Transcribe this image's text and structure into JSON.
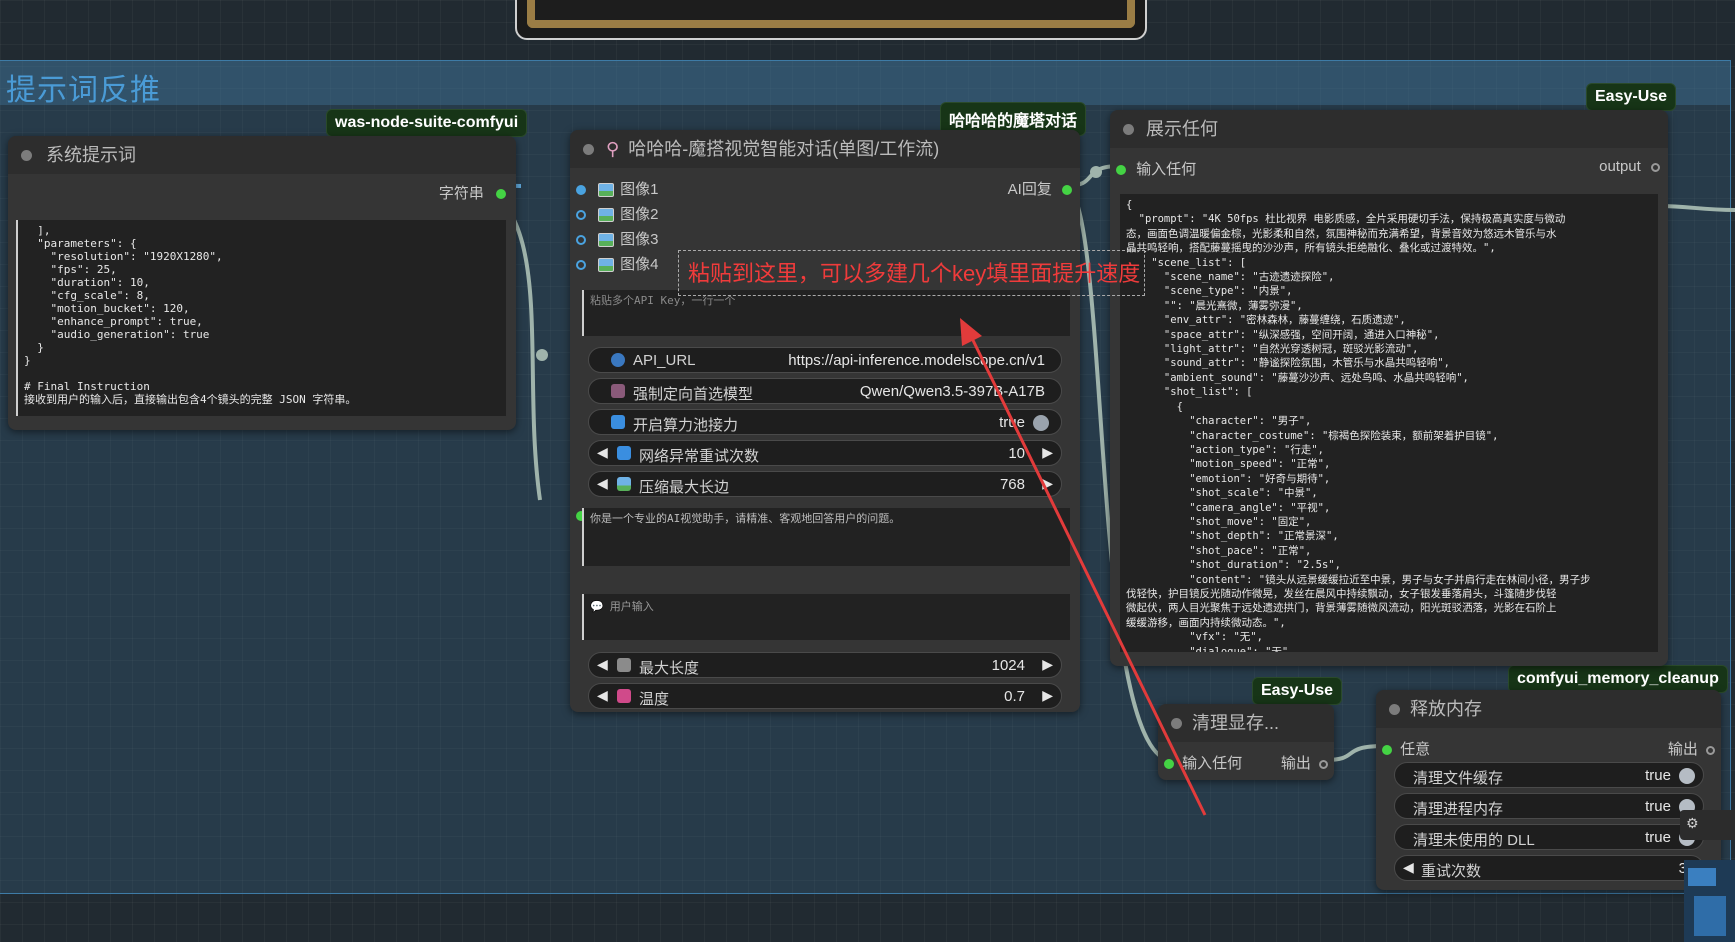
{
  "group": {
    "title": "提示词反推"
  },
  "badges": {
    "was": "was-node-suite-comfyui",
    "haha": "哈哈哈的魔塔对话",
    "easyuse1": "Easy-Use",
    "easyuse2": "Easy-Use",
    "cleanup": "comfyui_memory_cleanup"
  },
  "node_system": {
    "title": "系统提示词",
    "output_label": "字符串",
    "text": "  ],\n  \"parameters\": {\n    \"resolution\": \"1920X1280\",\n    \"fps\": 25,\n    \"duration\": 10,\n    \"cfg_scale\": 8,\n    \"motion_bucket\": 120,\n    \"enhance_prompt\": true,\n    \"audio_generation\": true\n  }\n}\n\n# Final Instruction\n接收到用户的输入后，直接输出包含4个镜头的完整 JSON 字符串。"
  },
  "node_chat": {
    "title": "哈哈哈-魔搭视觉智能对话(单图/工作流)",
    "inputs": [
      "图像1",
      "图像2",
      "图像3",
      "图像4"
    ],
    "output_label": "AI回复",
    "apikey_placeholder": "粘贴多个API Key，一行一个",
    "widgets": {
      "api_url_label": "API_URL",
      "api_url_value": "https://api-inference.modelscope.cn/v1",
      "model_label": "强制定向首选模型",
      "model_value": "Qwen/Qwen3.5-397B-A17B",
      "pool_label": "开启算力池接力",
      "pool_value": "true",
      "retry_label": "网络异常重试次数",
      "retry_value": "10",
      "maxedge_label": "压缩最大长边",
      "maxedge_value": "768",
      "maxlen_label": "最大长度",
      "maxlen_value": "1024",
      "temp_label": "温度",
      "temp_value": "0.7"
    },
    "system_text": "你是一个专业的AI视觉助手，请精准、客观地回答用户的问题。",
    "user_input_placeholder": "用户输入"
  },
  "annotation": "粘贴到这里，可以多建几个key填里面提升速度",
  "node_show": {
    "title": "展示任何",
    "input_label": "输入任何",
    "output_label": "output",
    "text": "{\n  \"prompt\": \"4K 50fps 杜比视界 电影质感，全片采用硬切手法，保持极高真实度与微动\n态，画面色调温暖偏金棕，光影柔和自然，氛围神秘而充满希望，背景音效为悠远木管乐与水\n晶共鸣轻响，搭配藤蔓摇曳的沙沙声，所有镜头拒绝融化、叠化或过渡特效。\",\n    \"scene_list\": [\n      \"scene_name\": \"古迹遗迹探险\",\n      \"scene_type\": \"内景\",\n      \"\": \"晨光熹微，薄雾弥漫\",\n      \"env_attr\": \"密林森林，藤蔓缠绕，石质遗迹\",\n      \"space_attr\": \"纵深感强，空间开阔，通进入口神秘\",\n      \"light_attr\": \"自然光穿透树冠，斑驳光影流动\",\n      \"sound_attr\": \"静谧探险氛围，木管乐与水晶共鸣轻响\",\n      \"ambient_sound\": \"藤蔓沙沙声、远处鸟鸣、水晶共鸣轻响\",\n      \"shot_list\": [\n        {\n          \"character\": \"男子\",\n          \"character_costume\": \"棕褐色探险装束，额前架着护目镜\",\n          \"action_type\": \"行走\",\n          \"motion_speed\": \"正常\",\n          \"emotion\": \"好奇与期待\",\n          \"shot_scale\": \"中景\",\n          \"camera_angle\": \"平视\",\n          \"shot_move\": \"固定\",\n          \"shot_depth\": \"正常景深\",\n          \"shot_pace\": \"正常\",\n          \"shot_duration\": \"2.5s\",\n          \"content\": \"镜头从远景缓缓拉近至中景，男子与女子并肩行走在林间小径，男子步\n伐轻快，护目镜反光随动作微晃，发丝在晨风中持续飘动，女子银发垂落肩头，斗篷随步伐轻\n微起伏，两人目光聚焦于远处遗迹拱门，背景薄雾随微风流动，阳光斑驳洒落，光影在石阶上\n缓缓游移，画面内持续微动态。\",\n          \"vfx\": \"无\",\n          \"dialogue\": \"无\","
  },
  "node_clean": {
    "title": "清理显存...",
    "input_label": "输入任何",
    "output_label": "输出"
  },
  "node_release": {
    "title": "释放内存",
    "input_label": "任意",
    "output_label": "输出",
    "rows": [
      {
        "label": "清理文件缓存",
        "value": "true"
      },
      {
        "label": "清理进程内存",
        "value": "true"
      },
      {
        "label": "清理未使用的 DLL",
        "value": "true"
      },
      {
        "label": "重试次数",
        "value": "3"
      }
    ]
  }
}
